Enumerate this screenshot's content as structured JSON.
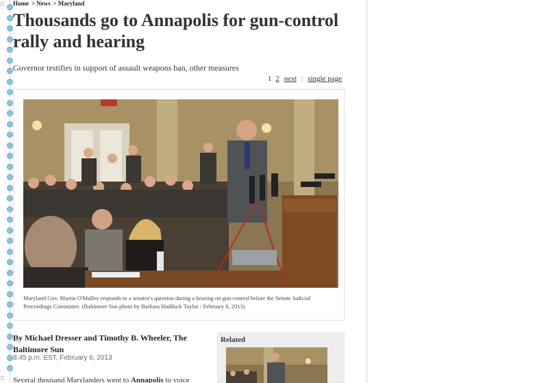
{
  "breadcrumb": {
    "home": "Home",
    "news": "News",
    "section": "Maryland",
    "separator": ">"
  },
  "article": {
    "headline": "Thousands go to Annapolis for gun-control rally and hearing",
    "subhead": "Governor testifies in support of assault weapons ban, other measures",
    "photo_caption": "Maryland Gov. Martin O'Malley responds to a senator's question during a hearing on gun control before the Senate Judicial Proceedings Committee. (Baltimore Sun photo by Barbara Haddock Taylor / February 6, 2013)",
    "byline": "By Michael Dresser and Timothy B. Wheeler, The Baltimore Sun",
    "timestamp": "8:45 p.m. EST, February 6, 2013",
    "lede_start": "Several thousand Marylanders went to ",
    "lede_link": "Annapolis",
    "lede_end": " to voice"
  },
  "pager": {
    "page1": "1",
    "page2": "2",
    "next": "next",
    "separator": "|",
    "single_page": "single page"
  },
  "related": {
    "title": "Related"
  },
  "colors": {
    "dot_rail": "#8fc3dc",
    "headline": "#333333",
    "related_bg": "#eeeeee"
  }
}
